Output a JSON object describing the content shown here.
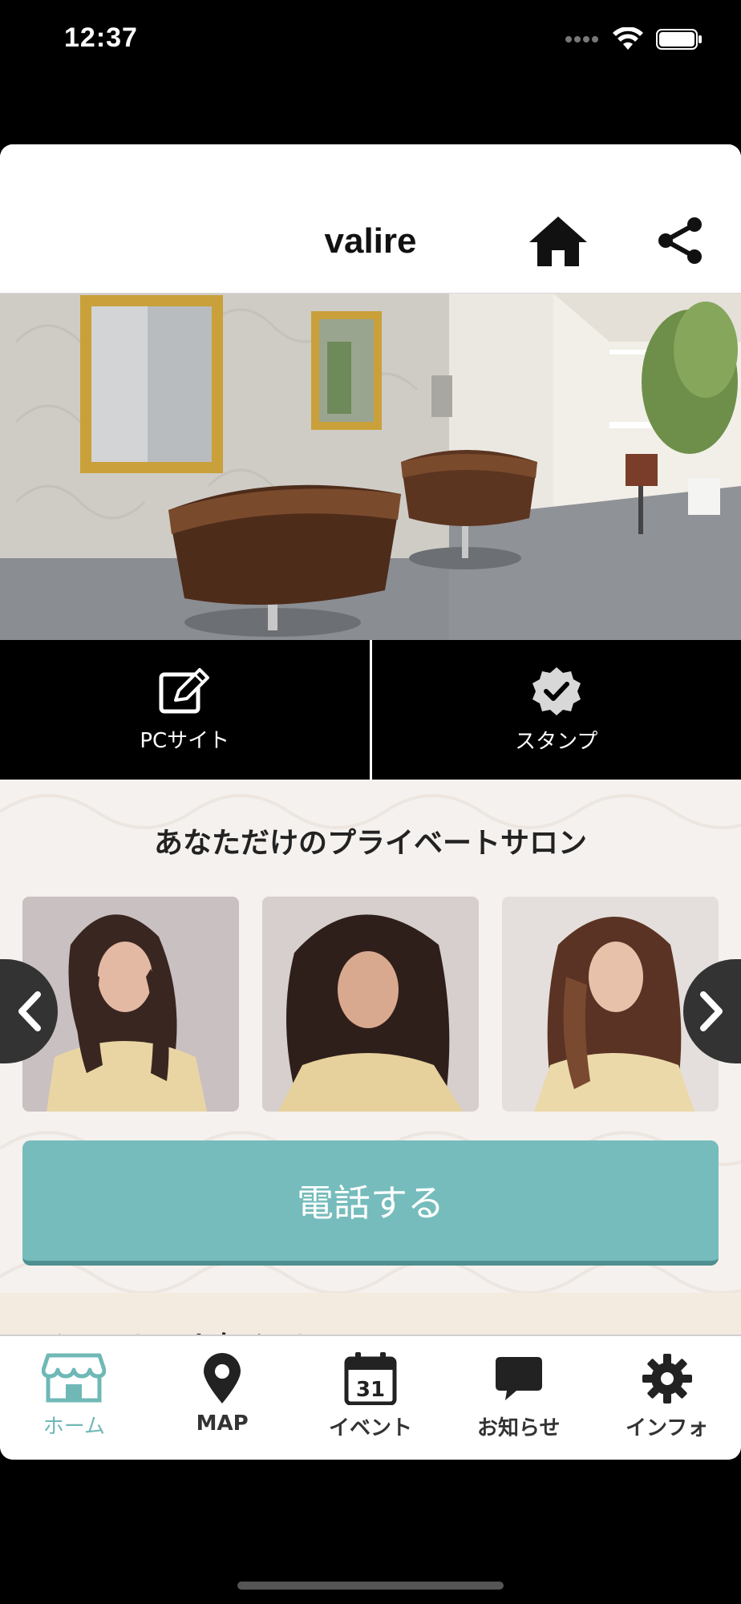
{
  "status_bar": {
    "time": "12:37"
  },
  "header": {
    "title": "valire"
  },
  "quick_actions": [
    {
      "label": "PCサイト",
      "icon": "edit-icon"
    },
    {
      "label": "スタンプ",
      "icon": "verified-badge-icon"
    }
  ],
  "content": {
    "heading": "あなただけのプライベートサロン",
    "gallery": [
      {
        "alt": "hair-model-photo"
      },
      {
        "alt": "hair-model-photo"
      },
      {
        "alt": "hair-model-photo"
      }
    ],
    "call_button": "電話する",
    "news_heading": "イベント・お知らせ"
  },
  "tabs": [
    {
      "label": "ホーム",
      "icon": "store-icon",
      "active": true
    },
    {
      "label": "MAP",
      "icon": "map-pin-icon"
    },
    {
      "label": "イベント",
      "icon": "calendar-icon",
      "calendar_day": "31"
    },
    {
      "label": "お知らせ",
      "icon": "chat-bubble-icon"
    },
    {
      "label": "インフォ",
      "icon": "gear-icon"
    }
  ],
  "colors": {
    "accent": "#76bcbc",
    "tab_active": "#6fb8b6"
  }
}
